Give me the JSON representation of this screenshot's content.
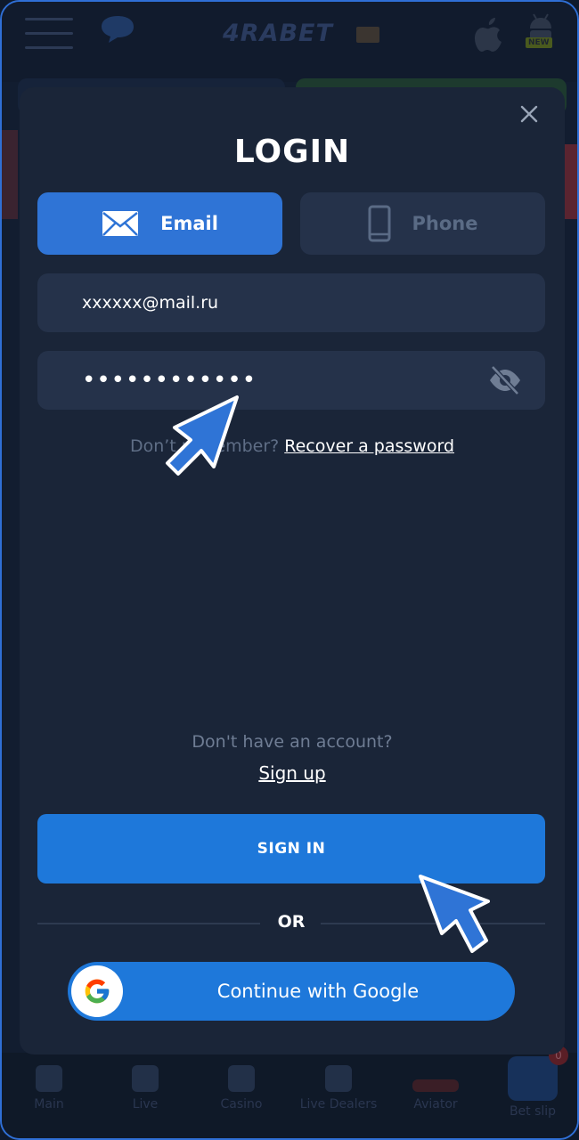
{
  "app": {
    "logo_text": "4RABET",
    "new_badge": "NEW"
  },
  "modal": {
    "title": "LOGIN",
    "tabs": [
      {
        "label": "Email",
        "icon": "envelope-icon",
        "active": true
      },
      {
        "label": "Phone",
        "icon": "phone-icon",
        "active": false
      }
    ],
    "email_value": "xxxxxx@mail.ru",
    "password_value": "••••••••••••",
    "recover_prefix": "Don’t remember?",
    "recover_link": "Recover a password",
    "no_account_text": "Don't have an account?",
    "signup_link": "Sign up",
    "signin_label": "SIGN IN",
    "or_label": "OR",
    "google_label": "Continue with Google"
  },
  "bottom_nav": {
    "items": [
      {
        "label": "Main"
      },
      {
        "label": "Live"
      },
      {
        "label": "Casino"
      },
      {
        "label": "Live Dealers"
      },
      {
        "label": "Aviator"
      },
      {
        "label": "Bet slip"
      }
    ],
    "betslip_count": "0"
  },
  "colors": {
    "accent": "#1e78da",
    "tab_active": "#2f74d6",
    "modal_bg": "#1a2538",
    "field_bg": "#25324a",
    "frame_border": "#2f6fd6"
  }
}
